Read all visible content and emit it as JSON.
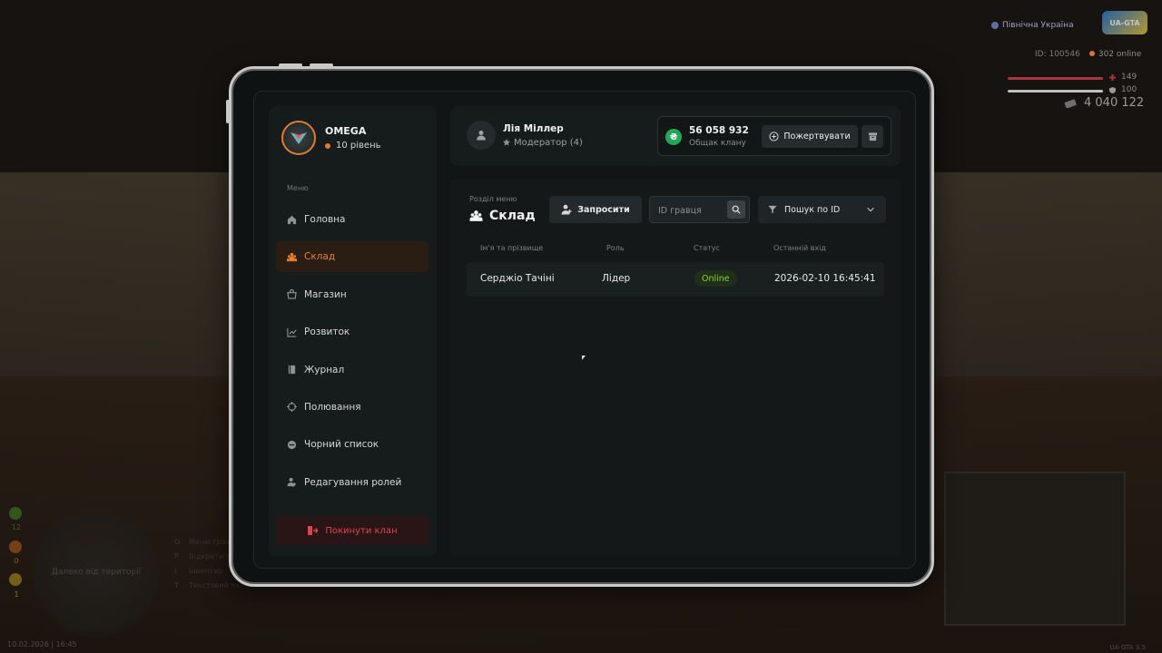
{
  "hud": {
    "server_name": "Північна Україна",
    "logo_text": "UA-GTA",
    "player_id": "ID: 100546",
    "online": "302 online",
    "health": "149",
    "armor": "100",
    "money": "4 040 122",
    "left_stats": [
      "12",
      "0",
      "1"
    ],
    "minimap_text": "Далеко від території",
    "hotkeys": [
      {
        "key": "O",
        "label": "Меню гравця"
      },
      {
        "key": "P",
        "label": "Відкрити телефон"
      },
      {
        "key": "I",
        "label": "Інвентар"
      },
      {
        "key": "T",
        "label": "Текстовий чат"
      }
    ],
    "datetime": "10.02.2026 | 16:45",
    "version": "UA-GTA 3.5"
  },
  "clan": {
    "name": "OMEGA",
    "level": "10 рівень",
    "accent": "#e07b2c"
  },
  "sidebar": {
    "menu_title": "Меню",
    "items": [
      {
        "label": "Головна",
        "icon": "home-icon",
        "active": false
      },
      {
        "label": "Склад",
        "icon": "members-icon",
        "active": true
      },
      {
        "label": "Магазин",
        "icon": "shop-icon",
        "active": false
      },
      {
        "label": "Розвиток",
        "icon": "chart-icon",
        "active": false
      },
      {
        "label": "Журнал",
        "icon": "journal-icon",
        "active": false
      },
      {
        "label": "Полювання",
        "icon": "crosshair-icon",
        "active": false
      },
      {
        "label": "Чорний список",
        "icon": "block-icon",
        "active": false
      },
      {
        "label": "Редагування ролей",
        "icon": "user-edit-icon",
        "active": false
      }
    ],
    "leave_label": "Покинути клан"
  },
  "header": {
    "user_name": "Лія Міллер",
    "user_role": "Модератор (4)",
    "balance": "56 058 932",
    "balance_label": "Общак клану",
    "donate_label": "Пожертвувати"
  },
  "main": {
    "section_label": "Розділ меню",
    "section_title": "Склад",
    "invite_label": "Запросити",
    "search_placeholder": "ID гравця",
    "filter_label": "Пошук по ID",
    "columns": [
      "Ім'я та прізвище",
      "Роль",
      "Статус",
      "Останній вхід"
    ],
    "rows": [
      {
        "name": "Серджіо Тачіні",
        "role": "Лідер",
        "status": "Online",
        "last_login": "2026-02-10 16:45:41"
      }
    ]
  }
}
